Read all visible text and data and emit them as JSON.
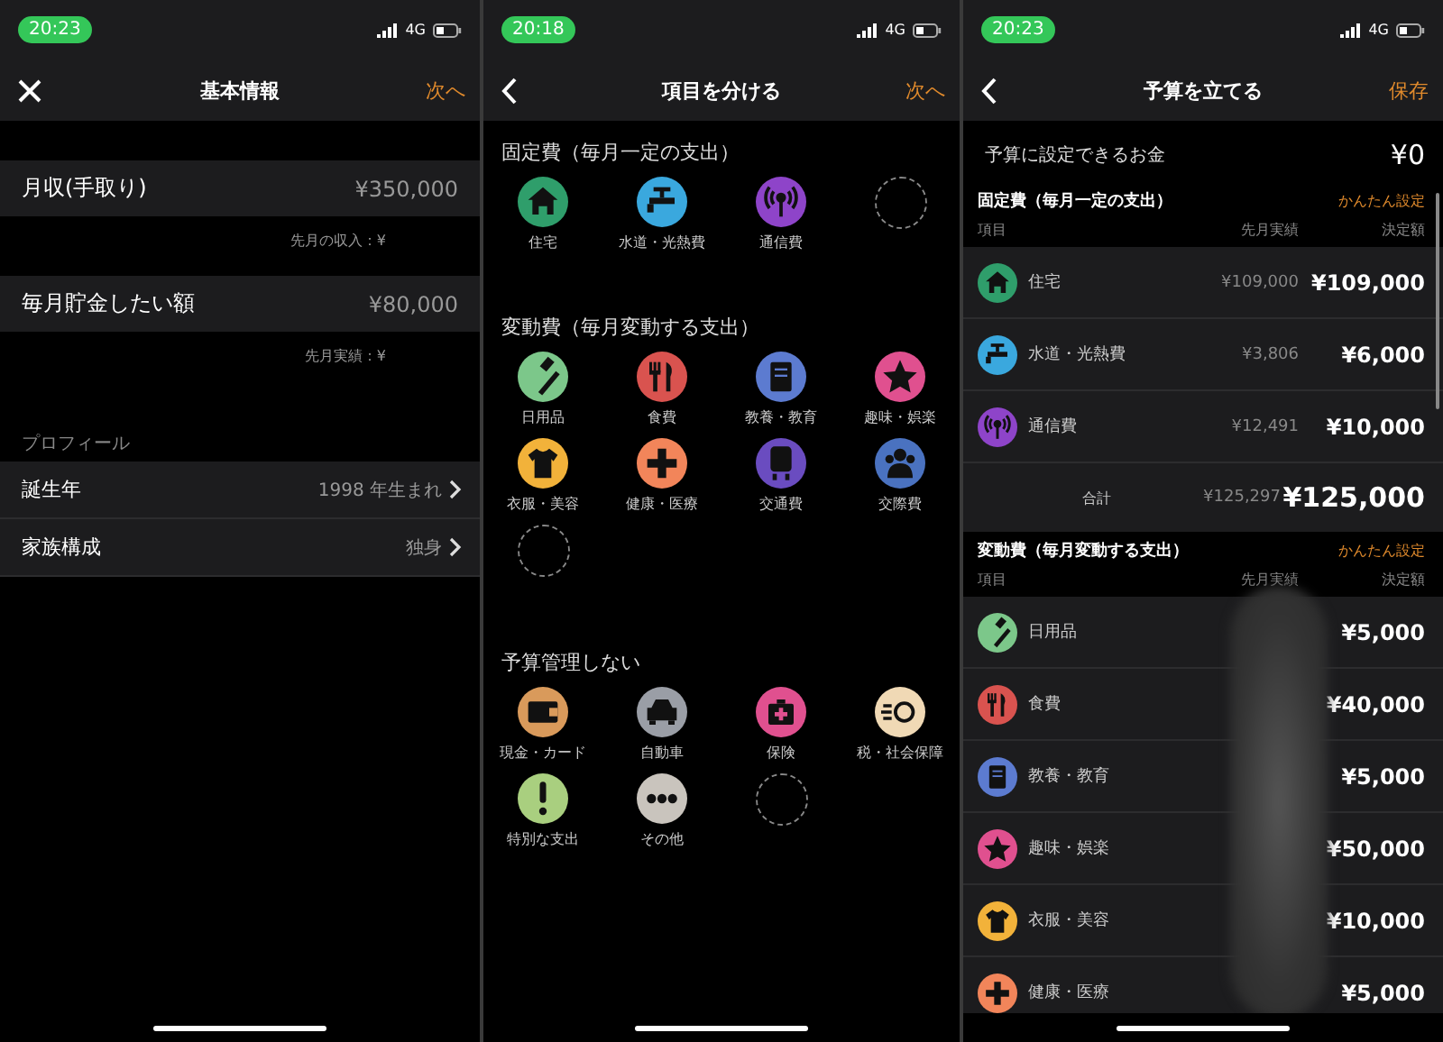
{
  "screens": [
    {
      "kind": "form",
      "time": "20:23",
      "network": "4G",
      "nav": {
        "kind": "close",
        "title": "基本情報",
        "action": "次へ"
      },
      "fields": [
        {
          "label": "月収(手取り)",
          "value": "¥350,000",
          "note": "先月の収入：¥"
        },
        {
          "label": "毎月貯金したい額",
          "value": "¥80,000",
          "note": "先月実績：¥"
        }
      ],
      "section_title": "プロフィール",
      "profile": [
        {
          "label": "誕生年",
          "value": "1998 年生まれ"
        },
        {
          "label": "家族構成",
          "value": "独身"
        }
      ]
    },
    {
      "kind": "categories",
      "time": "20:18",
      "network": "4G",
      "nav": {
        "kind": "back",
        "title": "項目を分ける",
        "action": "次へ"
      },
      "groups": [
        {
          "title": "固定費（毎月一定の支出）",
          "items": [
            {
              "kind": "house",
              "label": "住宅",
              "color": "#2f9e6b"
            },
            {
              "kind": "tap",
              "label": "水道・光熱費",
              "color": "#3aa8de"
            },
            {
              "kind": "antenna",
              "label": "通信費",
              "color": "#8e44c9"
            },
            {
              "kind": "empty"
            }
          ]
        },
        {
          "title": "変動費（毎月変動する支出）",
          "items": [
            {
              "kind": "toothbrush",
              "label": "日用品",
              "color": "#7cc78a"
            },
            {
              "kind": "cutlery",
              "label": "食費",
              "color": "#d9534f"
            },
            {
              "kind": "book",
              "label": "教養・教育",
              "color": "#5c7bd0"
            },
            {
              "kind": "star",
              "label": "趣味・娯楽",
              "color": "#e0508f"
            },
            {
              "kind": "shirt",
              "label": "衣服・美容",
              "color": "#f2b23a"
            },
            {
              "kind": "cross",
              "label": "健康・医療",
              "color": "#f2855a"
            },
            {
              "kind": "train",
              "label": "交通費",
              "color": "#6a4cc0"
            },
            {
              "kind": "people",
              "label": "交際費",
              "color": "#4a72c0"
            },
            {
              "kind": "empty"
            }
          ]
        },
        {
          "title": "予算管理しない",
          "items": [
            {
              "kind": "wallet",
              "label": "現金・カード",
              "color": "#d99a5b"
            },
            {
              "kind": "car",
              "label": "自動車",
              "color": "#9a9ea6"
            },
            {
              "kind": "firstaid",
              "label": "保険",
              "color": "#e0508f"
            },
            {
              "kind": "coin",
              "label": "税・社会保障",
              "color": "#f0d9b5"
            },
            {
              "kind": "exclaim",
              "label": "特別な支出",
              "color": "#a9cf7f"
            },
            {
              "kind": "dots",
              "label": "その他",
              "color": "#c9c4bd"
            },
            {
              "kind": "empty"
            }
          ]
        }
      ]
    },
    {
      "kind": "budget",
      "time": "20:23",
      "network": "4G",
      "nav": {
        "kind": "back",
        "title": "予算を立てる",
        "action": "保存"
      },
      "available": {
        "label": "予算に設定できるお金",
        "value": "¥0"
      },
      "sections": [
        {
          "title": "固定費（毎月一定の支出）",
          "link": "かんたん設定",
          "columns": [
            "項目",
            "先月実績",
            "決定額"
          ],
          "rows": [
            {
              "kind": "house",
              "label": "住宅",
              "color": "#2f9e6b",
              "last": "¥109,000",
              "decided": "¥109,000"
            },
            {
              "kind": "tap",
              "label": "水道・光熱費",
              "color": "#3aa8de",
              "last": "¥3,806",
              "decided": "¥6,000"
            },
            {
              "kind": "antenna",
              "label": "通信費",
              "color": "#8e44c9",
              "last": "¥12,491",
              "decided": "¥10,000"
            }
          ],
          "total": {
            "label": "合計",
            "last": "¥125,297",
            "decided": "¥125,000"
          }
        },
        {
          "title": "変動費（毎月変動する支出）",
          "link": "かんたん設定",
          "columns": [
            "項目",
            "先月実績",
            "決定額"
          ],
          "blurred": true,
          "rows": [
            {
              "kind": "toothbrush",
              "label": "日用品",
              "color": "#7cc78a",
              "decided": "¥5,000"
            },
            {
              "kind": "cutlery",
              "label": "食費",
              "color": "#d9534f",
              "decided": "¥40,000"
            },
            {
              "kind": "book",
              "label": "教養・教育",
              "color": "#5c7bd0",
              "decided": "¥5,000"
            },
            {
              "kind": "star",
              "label": "趣味・娯楽",
              "color": "#e0508f",
              "decided": "¥50,000"
            },
            {
              "kind": "shirt",
              "label": "衣服・美容",
              "color": "#f2b23a",
              "decided": "¥10,000"
            },
            {
              "kind": "cross",
              "label": "健康・医療",
              "color": "#f2855a",
              "decided": "¥5,000"
            }
          ]
        }
      ]
    }
  ]
}
